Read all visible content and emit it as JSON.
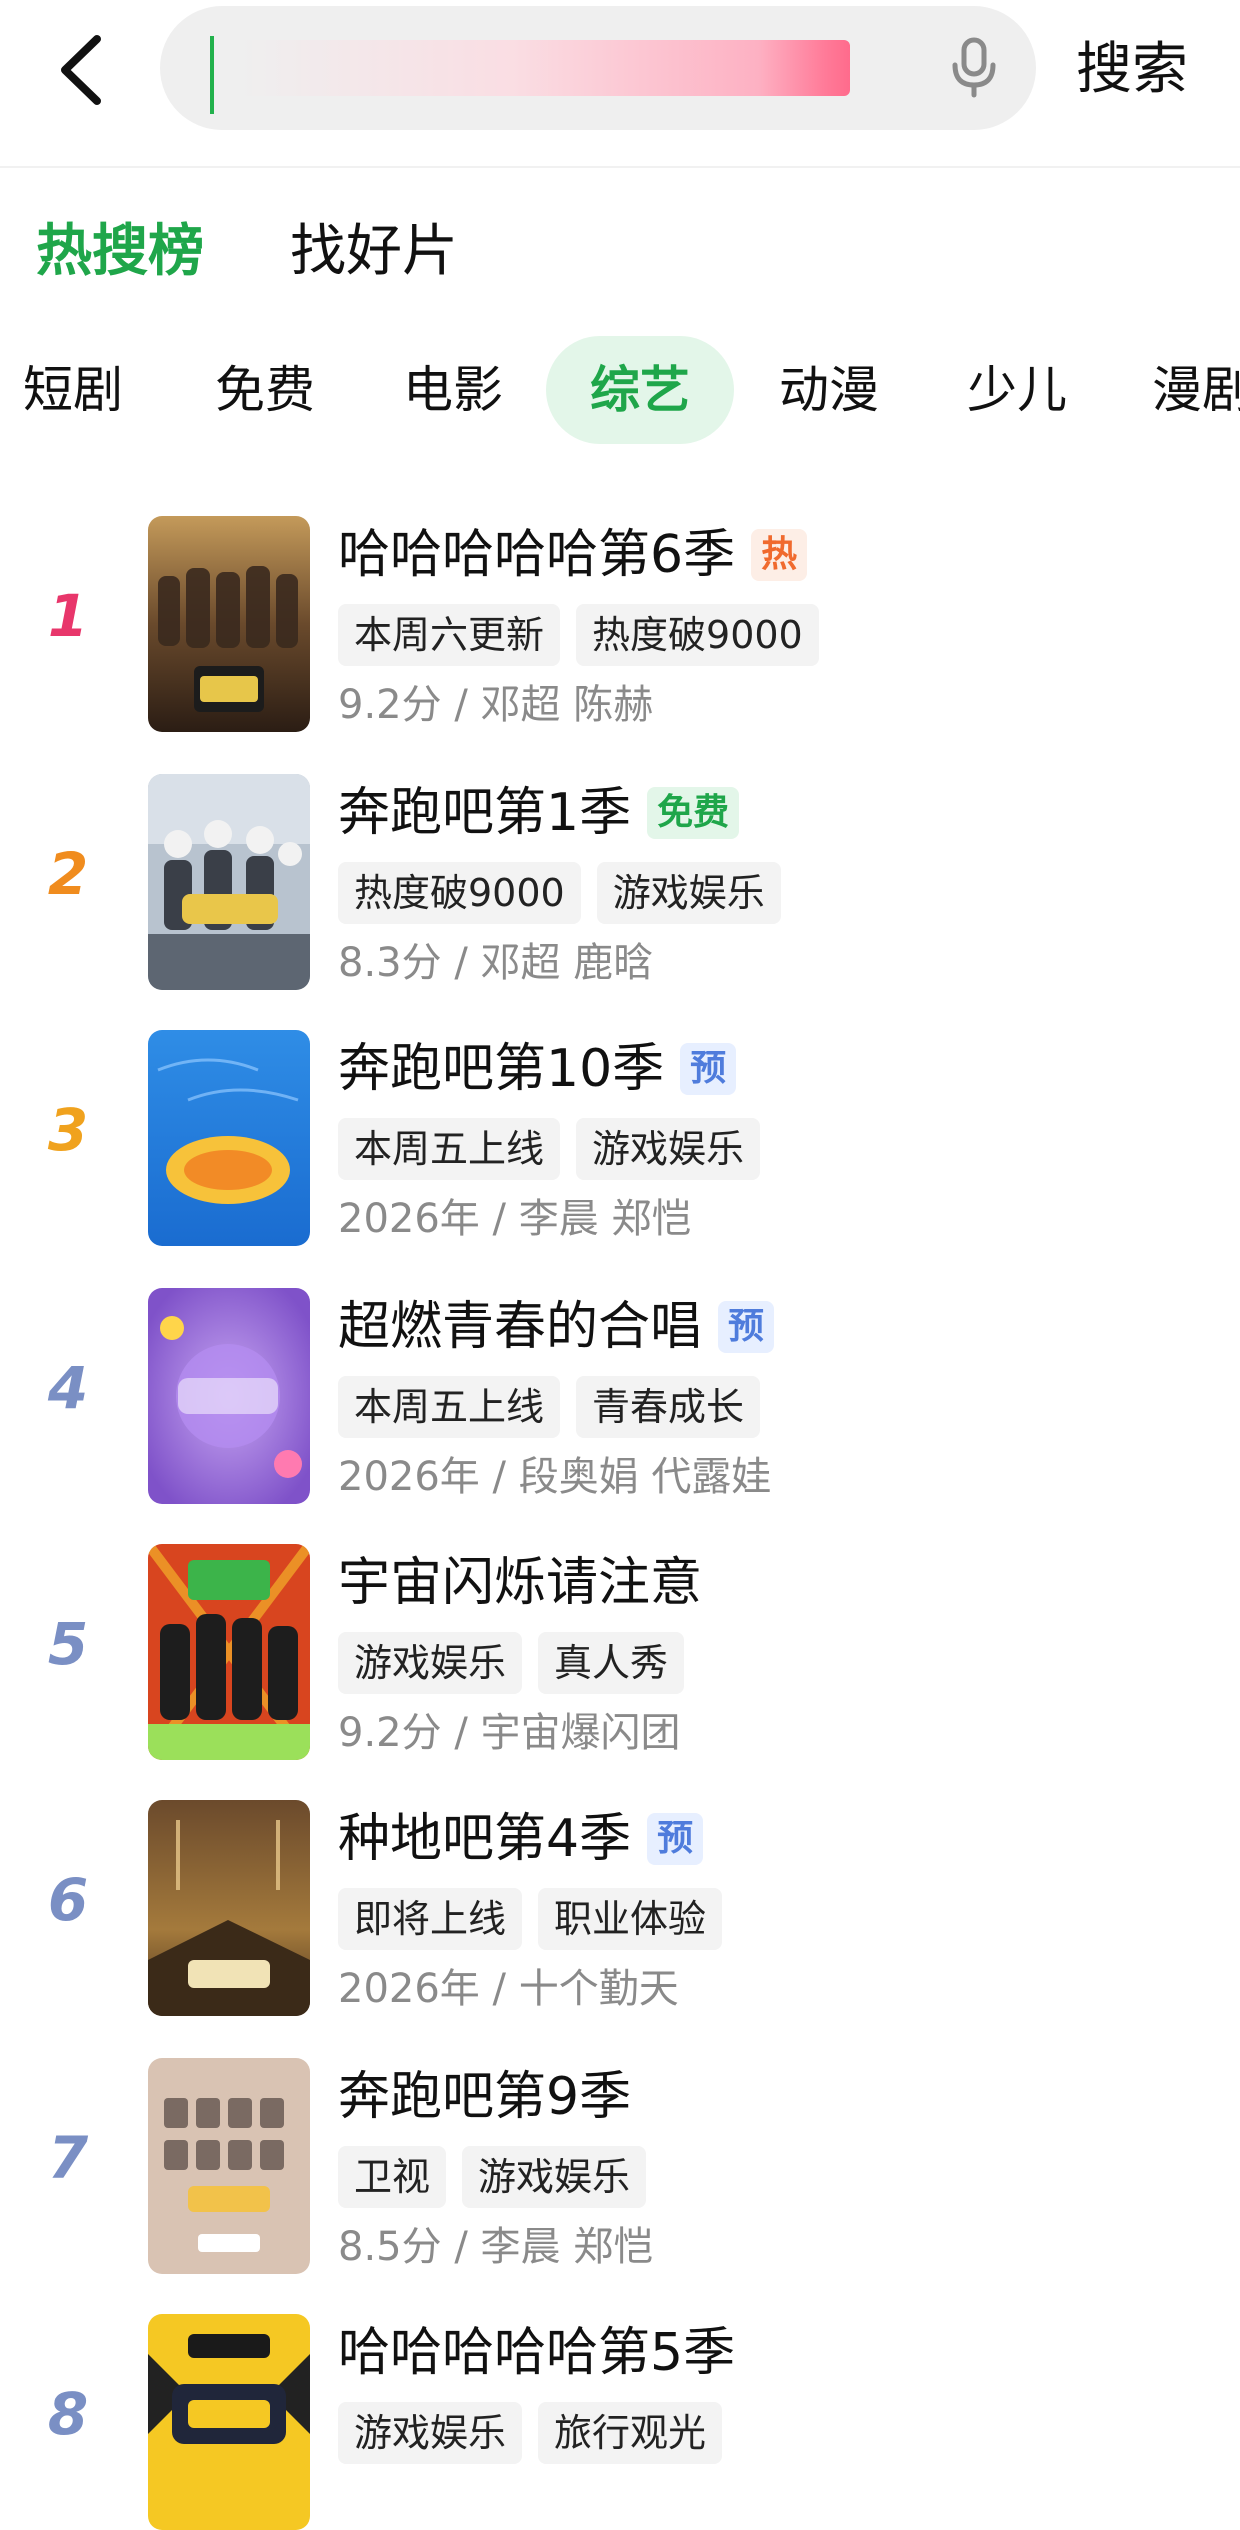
{
  "header": {
    "search_button_label": "搜索"
  },
  "section_tabs": [
    {
      "label": "热搜榜",
      "active": true
    },
    {
      "label": "找好片",
      "active": false
    }
  ],
  "category_tabs": [
    {
      "label": "短剧",
      "active": false
    },
    {
      "label": "免费",
      "active": false
    },
    {
      "label": "电影",
      "active": false
    },
    {
      "label": "综艺",
      "active": true
    },
    {
      "label": "动漫",
      "active": false
    },
    {
      "label": "少儿",
      "active": false
    },
    {
      "label": "漫剧",
      "active": false
    }
  ],
  "colors": {
    "accent_green": "#1fa64a",
    "rank1": "#e8366b",
    "rank2": "#f08c1e",
    "rank3": "#f0a21e",
    "rank_other": "#7a8fc4",
    "badge_hot_bg": "#fdeee6",
    "badge_hot_fg": "#f06a2e",
    "badge_free_bg": "#e3f6e9",
    "badge_free_fg": "#1fa64a",
    "badge_pre_bg": "#e7efff",
    "badge_pre_fg": "#4f7cdc"
  },
  "ranking": [
    {
      "rank": "1",
      "title": "哈哈哈哈哈第6季",
      "badge": "热",
      "badge_type": "hot",
      "tags": [
        "本周六更新",
        "热度破9000"
      ],
      "meta": "9.2分 / 邓超 陈赫"
    },
    {
      "rank": "2",
      "title": "奔跑吧第1季",
      "badge": "免费",
      "badge_type": "free",
      "tags": [
        "热度破9000",
        "游戏娱乐"
      ],
      "meta": "8.3分 / 邓超 鹿晗"
    },
    {
      "rank": "3",
      "title": "奔跑吧第10季",
      "badge": "预",
      "badge_type": "pre",
      "tags": [
        "本周五上线",
        "游戏娱乐"
      ],
      "meta": "2026年 / 李晨 郑恺"
    },
    {
      "rank": "4",
      "title": "超燃青春的合唱",
      "badge": "预",
      "badge_type": "pre",
      "tags": [
        "本周五上线",
        "青春成长"
      ],
      "meta": "2026年 / 段奥娟 代露娃"
    },
    {
      "rank": "5",
      "title": "宇宙闪烁请注意",
      "badge": "",
      "badge_type": "",
      "tags": [
        "游戏娱乐",
        "真人秀"
      ],
      "meta": "9.2分 / 宇宙爆闪团"
    },
    {
      "rank": "6",
      "title": "种地吧第4季",
      "badge": "预",
      "badge_type": "pre",
      "tags": [
        "即将上线",
        "职业体验"
      ],
      "meta": "2026年 / 十个勤天"
    },
    {
      "rank": "7",
      "title": "奔跑吧第9季",
      "badge": "",
      "badge_type": "",
      "tags": [
        "卫视",
        "游戏娱乐"
      ],
      "meta": "8.5分 / 李晨 郑恺"
    },
    {
      "rank": "8",
      "title": "哈哈哈哈哈第5季",
      "badge": "",
      "badge_type": "",
      "tags": [
        "游戏娱乐",
        "旅行观光"
      ],
      "meta": ""
    }
  ]
}
